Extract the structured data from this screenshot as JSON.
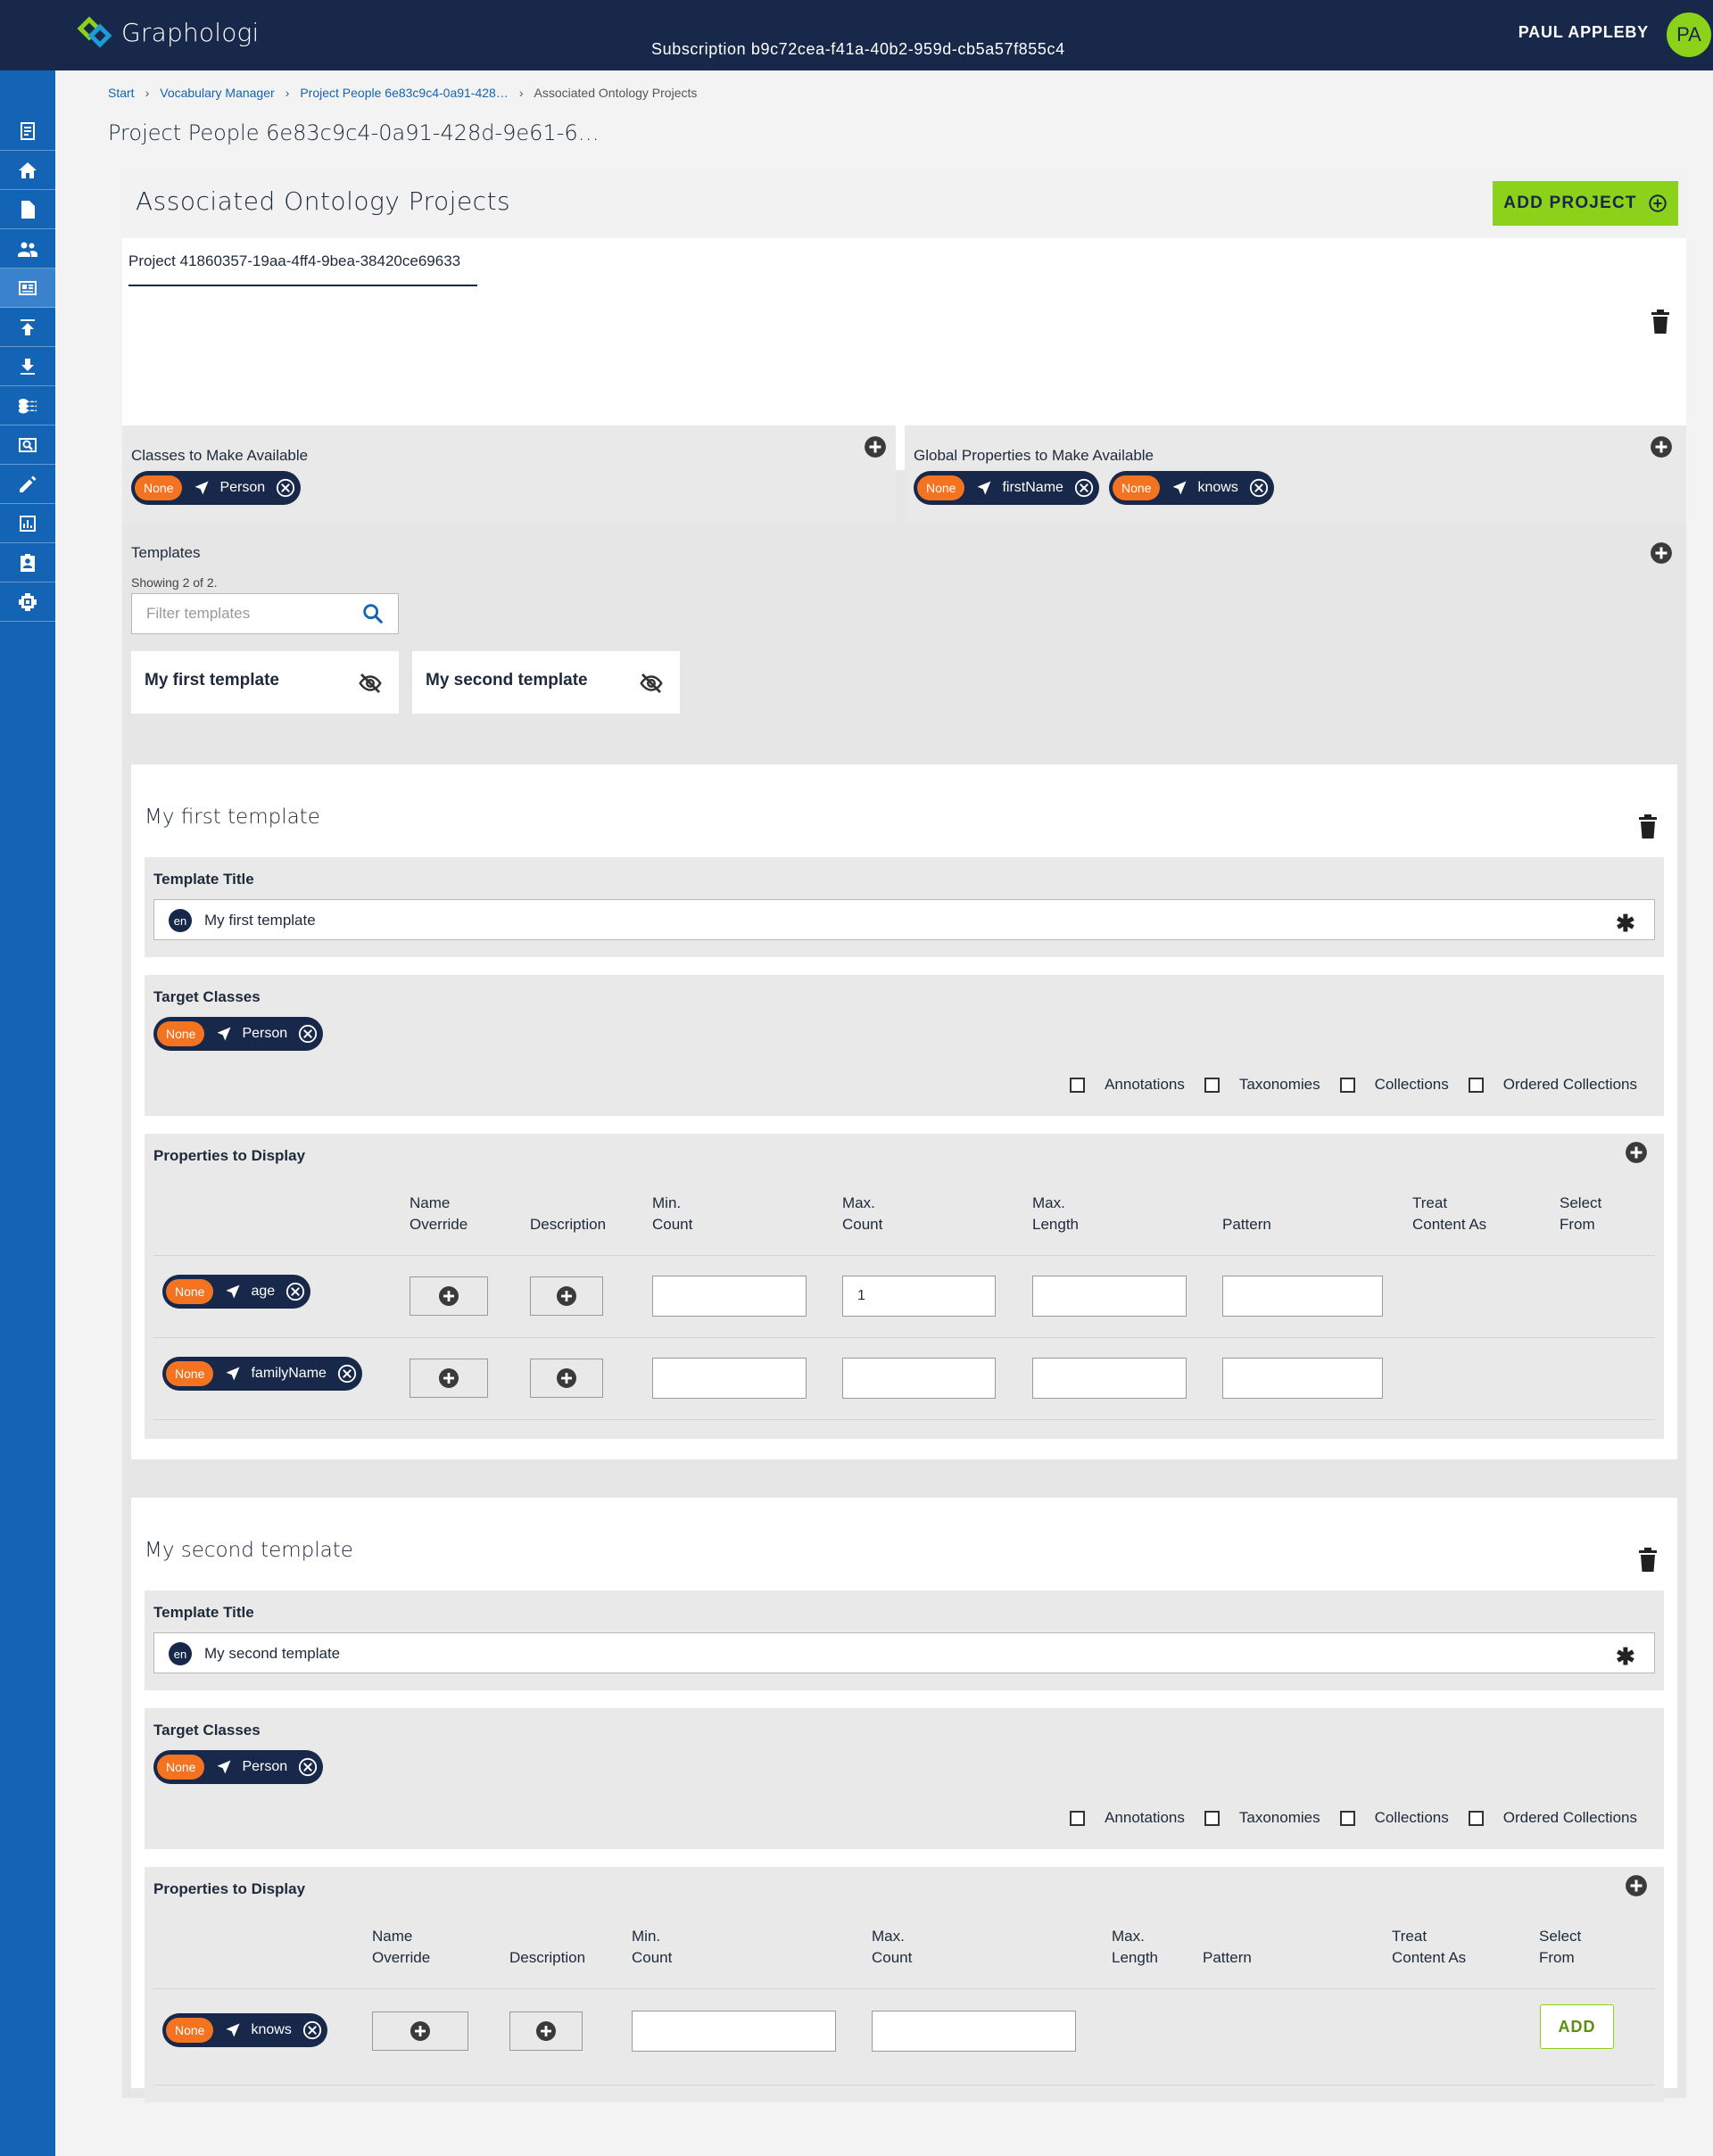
{
  "header": {
    "app_name": "Graphologi",
    "subscription": "Subscription b9c72cea-f41a-40b2-959d-cb5a57f855c4",
    "user_name": "PAUL APPLEBY",
    "user_initials": "PA"
  },
  "sidebar": {
    "items": [
      "document-icon",
      "home-icon",
      "file-icon",
      "people-icon",
      "dashboard-icon",
      "upload-icon",
      "download-icon",
      "waves-icon",
      "search-icon",
      "edit-icon",
      "chart-icon",
      "badge-icon",
      "settings-icon"
    ],
    "active_item": "dashboard-icon"
  },
  "breadcrumb": {
    "items": [
      "Start",
      "Vocabulary Manager",
      "Project People 6e83c9c4-0a91-428…"
    ],
    "current": "Associated Ontology Projects"
  },
  "page_title": "Project People 6e83c9c4-0a91-428d-9e61-6…",
  "panel": {
    "title": "Associated Ontology Projects",
    "add_project_label": "ADD PROJECT",
    "project_tab": "Project 41860357-19aa-4ff4-9bea-38420ce69633"
  },
  "chip_prefix": "None",
  "classes": {
    "label": "Classes to Make Available",
    "chips": [
      "Person"
    ]
  },
  "global_properties": {
    "label": "Global Properties to Make Available",
    "chips": [
      "firstName",
      "knows"
    ]
  },
  "templates": {
    "label": "Templates",
    "count_text": "Showing 2 of 2.",
    "filter_placeholder": "Filter templates",
    "cards": [
      "My first template",
      "My second template"
    ]
  },
  "template_blocks": [
    {
      "title": "My first template",
      "title_label": "Template Title",
      "lang": "en",
      "title_value": "My first template",
      "required_marker": "✱",
      "target_label": "Target Classes",
      "target_chips": [
        "Person"
      ],
      "checkboxes": [
        "Annotations",
        "Taxonomies",
        "Collections",
        "Ordered Collections"
      ],
      "properties_label": "Properties to Display",
      "columns": [
        "Name Override",
        "Description",
        "Min. Count",
        "Max. Count",
        "Max. Length",
        "Pattern",
        "Treat Content As",
        "Select From"
      ],
      "rows": [
        {
          "property": "age",
          "min_count": "",
          "max_count": "1",
          "max_length": "",
          "pattern": ""
        },
        {
          "property": "familyName",
          "min_count": "",
          "max_count": "",
          "max_length": "",
          "pattern": ""
        }
      ]
    },
    {
      "title": "My second template",
      "title_label": "Template Title",
      "lang": "en",
      "title_value": "My second template",
      "required_marker": "✱",
      "target_label": "Target Classes",
      "target_chips": [
        "Person"
      ],
      "checkboxes": [
        "Annotations",
        "Taxonomies",
        "Collections",
        "Ordered Collections"
      ],
      "properties_label": "Properties to Display",
      "columns": [
        "Name Override",
        "Description",
        "Min. Count",
        "Max. Count",
        "Max. Length",
        "Pattern",
        "Treat Content As",
        "Select From"
      ],
      "rows": [
        {
          "property": "knows",
          "min_count": "",
          "max_count": "",
          "select_from_label": "ADD"
        }
      ]
    }
  ],
  "colors": {
    "topbar": "#17284a",
    "sidebar": "#1364b5",
    "accent": "#8cd11a",
    "chip": "#17284a",
    "chip_none": "#f47321"
  }
}
